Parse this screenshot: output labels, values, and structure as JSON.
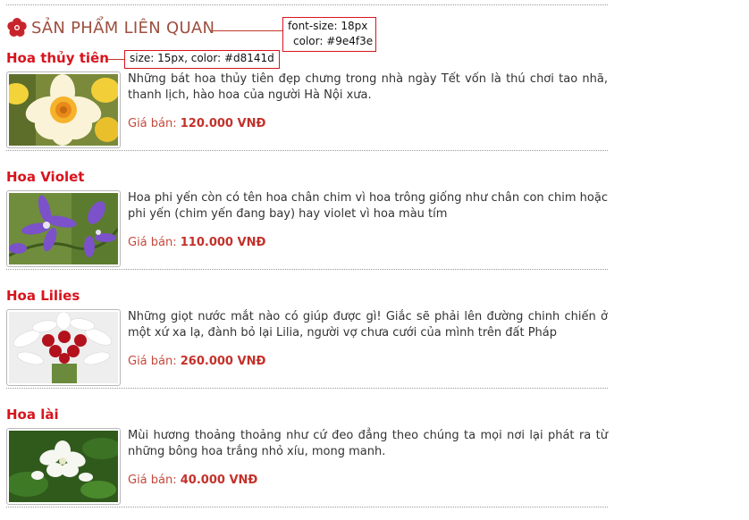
{
  "section": {
    "title": "SẢN PHẨM LIÊN QUAN",
    "icon": "flower-icon"
  },
  "colors": {
    "section_title": "#9e4f3e",
    "product_title": "#d8141d",
    "price": "#c4312a"
  },
  "annotations": {
    "title_note": {
      "line1": "font-size: 18px",
      "line2": "color: #9e4f3e"
    },
    "item_note": "size: 15px, color: #d8141d"
  },
  "products": [
    {
      "name": "Hoa thủy tiên",
      "description": "Những bát hoa thủy tiên đẹp chưng trong nhà ngày Tết vốn là thú chơi tao nhã, thanh lịch, hào hoa của người Hà Nội xưa.",
      "price_label": "Giá bán:",
      "price": "120.000 VNĐ",
      "image": "daffodil-photo"
    },
    {
      "name": "Hoa Violet",
      "description": "Hoa phi yến còn có tên hoa chân chim vì hoa trông giống như chân con chim hoặc phi yến (chim yến đang bay) hay violet vì hoa màu tím",
      "price_label": "Giá bán:",
      "price": "110.000 VNĐ",
      "image": "violet-photo"
    },
    {
      "name": "Hoa Lilies",
      "description": "Những giọt nước mắt nào có giúp được gì! Giắc sẽ phải lên đường chinh chiến ở một xứ xa lạ, đành bỏ lại Lilia, người vợ chưa cưới của mình trên đất Pháp",
      "price_label": "Giá bán:",
      "price": "260.000 VNĐ",
      "image": "lilies-photo"
    },
    {
      "name": "Hoa lài",
      "description": "Mùi hương thoảng thoảng như cứ đeo đẳng theo chúng ta mọi nơi lại phát ra từ những bông hoa trắng nhỏ xíu, mong manh.",
      "price_label": "Giá bán:",
      "price": "40.000 VNĐ",
      "image": "jasmine-photo"
    }
  ]
}
